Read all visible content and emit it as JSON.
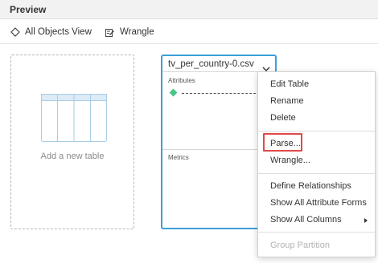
{
  "header": {
    "title": "Preview"
  },
  "toolbar": {
    "all_objects_label": "All Objects View",
    "wrangle_label": "Wrangle"
  },
  "add_table": {
    "label": "Add a new table"
  },
  "table_card": {
    "name": "tv_per_country-0.csv",
    "attributes_label": "Attributes",
    "metrics_label": "Metrics"
  },
  "context_menu": {
    "items": [
      {
        "label": "Edit Table"
      },
      {
        "label": "Rename"
      },
      {
        "label": "Delete"
      },
      {
        "label": "Parse..."
      },
      {
        "label": "Wrangle..."
      },
      {
        "label": "Define Relationships"
      },
      {
        "label": "Show All Attribute Forms"
      },
      {
        "label": "Show All Columns"
      },
      {
        "label": "Group Partition",
        "disabled": true
      }
    ]
  },
  "colors": {
    "card_border": "#3aa0d6",
    "highlight_box": "#e0494b",
    "attribute_diamond": "#4cc38a",
    "disabled_text": "#b3b3b3"
  },
  "icons": {
    "all_objects": "diamond-outline-icon",
    "wrangle": "wrangle-edit-icon",
    "add_table": "table-grid-icon",
    "card_menu": "chevron-down-icon",
    "attribute": "diamond-icon",
    "submenu": "caret-right-icon"
  }
}
